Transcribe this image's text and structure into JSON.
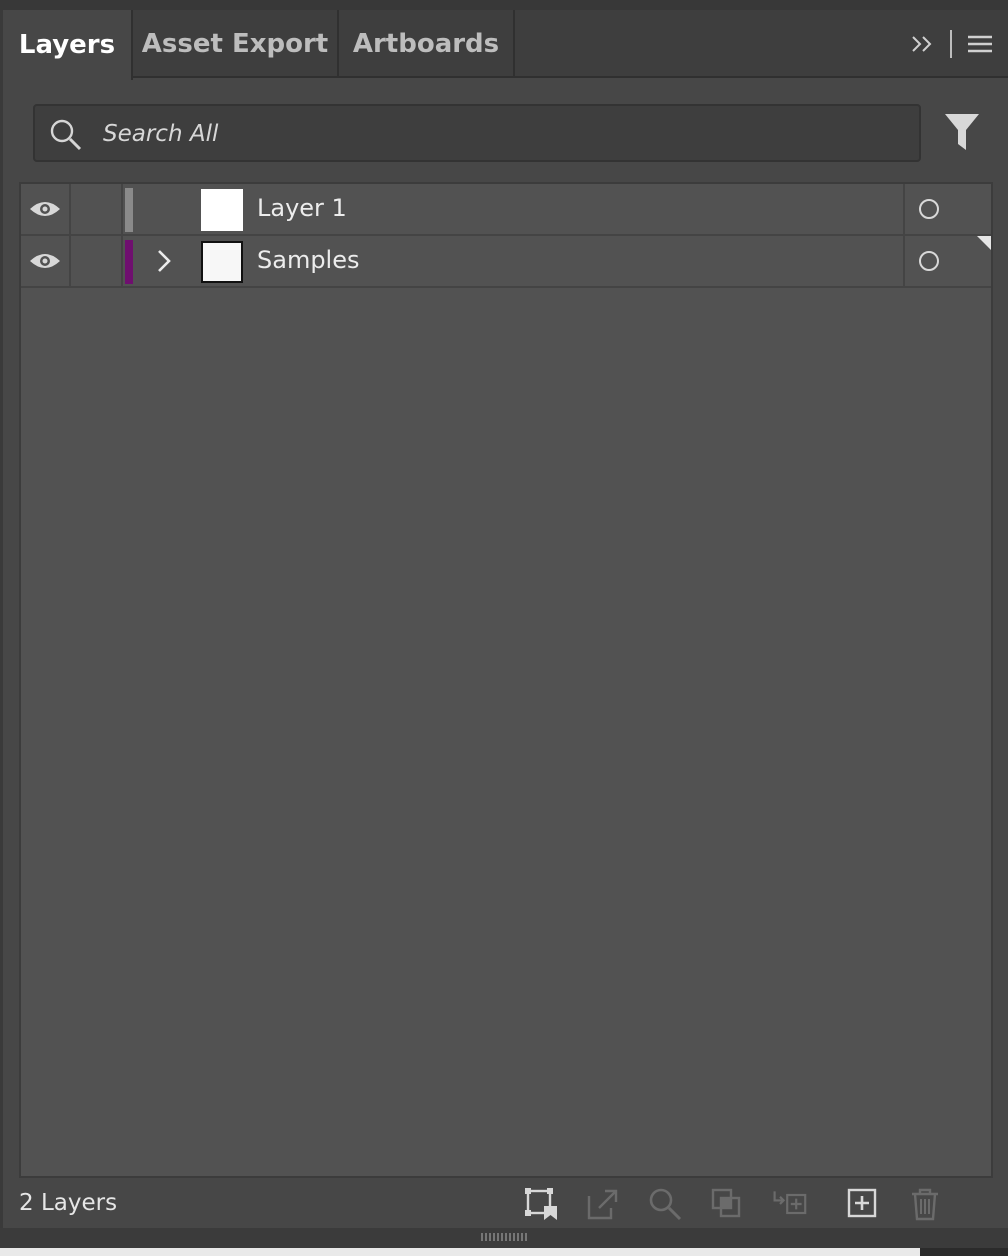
{
  "tabs": [
    {
      "label": "Layers",
      "active": true
    },
    {
      "label": "Asset Export",
      "active": false
    },
    {
      "label": "Artboards",
      "active": false
    }
  ],
  "header_icons": [
    "collapse-icon",
    "panel-menu-icon"
  ],
  "search": {
    "placeholder": "Search All"
  },
  "filter_icon": "filter-icon",
  "layers": [
    {
      "name": "Layer 1",
      "color": "#8a8a8a",
      "visible": true,
      "expandable": false
    },
    {
      "name": "Samples",
      "color": "#6f0f6f",
      "visible": true,
      "expandable": true
    }
  ],
  "footer": {
    "count_label": "2 Layers",
    "icons": [
      "collect-for-export-icon",
      "export-icon",
      "locate-object-icon",
      "make-clipping-mask-icon",
      "create-sublayer-icon",
      "create-new-layer-icon",
      "delete-icon"
    ]
  },
  "colors": {
    "panel": "#474747",
    "list": "#525252",
    "tabbar": "#3e3e3e"
  }
}
